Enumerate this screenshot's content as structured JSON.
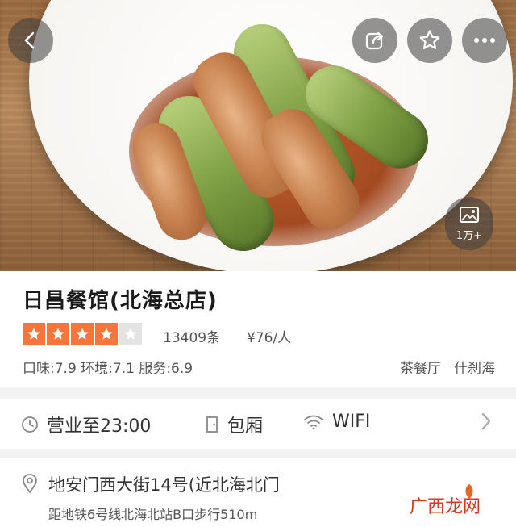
{
  "header": {
    "photo_count": "1万+",
    "icons": [
      "back-icon",
      "share-icon",
      "star-icon",
      "more-icon",
      "image-icon"
    ]
  },
  "restaurant": {
    "name": "日昌餐馆(北海总店)",
    "rating_stars": 4,
    "rating_max": 5,
    "review_count": "13409条",
    "avg_price": "¥76/人",
    "scores": "口味:7.9 环境:7.1 服务:6.9",
    "tags": [
      "茶餐厅",
      "什刹海"
    ]
  },
  "facilities": {
    "hours": "营业至23:00",
    "private_room": "包厢",
    "wifi": "WIFI"
  },
  "location": {
    "address": "地安门西大街14号(近北海北门",
    "subway": "距地铁6号线北海北站B口步行510m"
  },
  "watermark": "广西龙网",
  "colors": {
    "accent": "#f5753a",
    "star_off": "#e3e3e3",
    "watermark": "#d83a1f"
  }
}
